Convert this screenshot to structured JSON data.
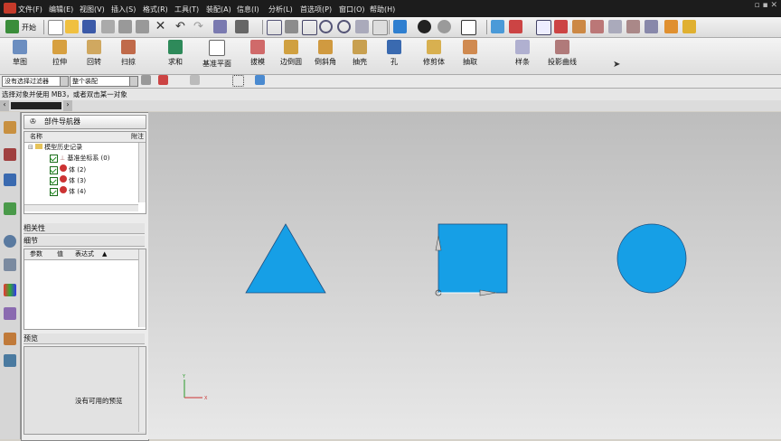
{
  "menu": [
    "文件(F)",
    "编辑(E)",
    "视图(V)",
    "插入(S)",
    "格式(R)",
    "工具(T)",
    "装配(A)",
    "信息(I)",
    "分析(L)",
    "首选项(P)",
    "窗口(O)",
    "帮助(H)"
  ],
  "toolbar": {
    "start_label": "开始"
  },
  "features": [
    "草图",
    "拉伸",
    "回转",
    "扫掠",
    "求和",
    "基准平面",
    "拔模",
    "边倒圆",
    "倒斜角",
    "抽壳",
    "孔",
    "修剪体",
    "抽取",
    "样条",
    "投影曲线"
  ],
  "selection": {
    "filter_value": "没有选择过滤器",
    "scope_value": "整个装配"
  },
  "status_text": "选择对象并使用 MB3，或者双击某一对象",
  "navigator": {
    "title": "部件导航器",
    "col_name": "名称",
    "col_note": "附注",
    "tree": [
      {
        "label": "模型历史记录"
      },
      {
        "label": "基准坐标系 (0)"
      },
      {
        "label": "体 (2)"
      },
      {
        "label": "体 (3)"
      },
      {
        "label": "体 (4)"
      }
    ],
    "dependencies_title": "相关性",
    "details_title": "细节",
    "details_cols": [
      "参数",
      "值",
      "表达式"
    ],
    "preview_title": "预览",
    "preview_empty": "没有可用的预览"
  },
  "triad": {
    "x_label": "X",
    "y_label": "Y"
  },
  "colors": {
    "shape_fill": "#169fe6",
    "shape_stroke": "#1e4f80",
    "menubar_bg": "#1c1c1c"
  }
}
